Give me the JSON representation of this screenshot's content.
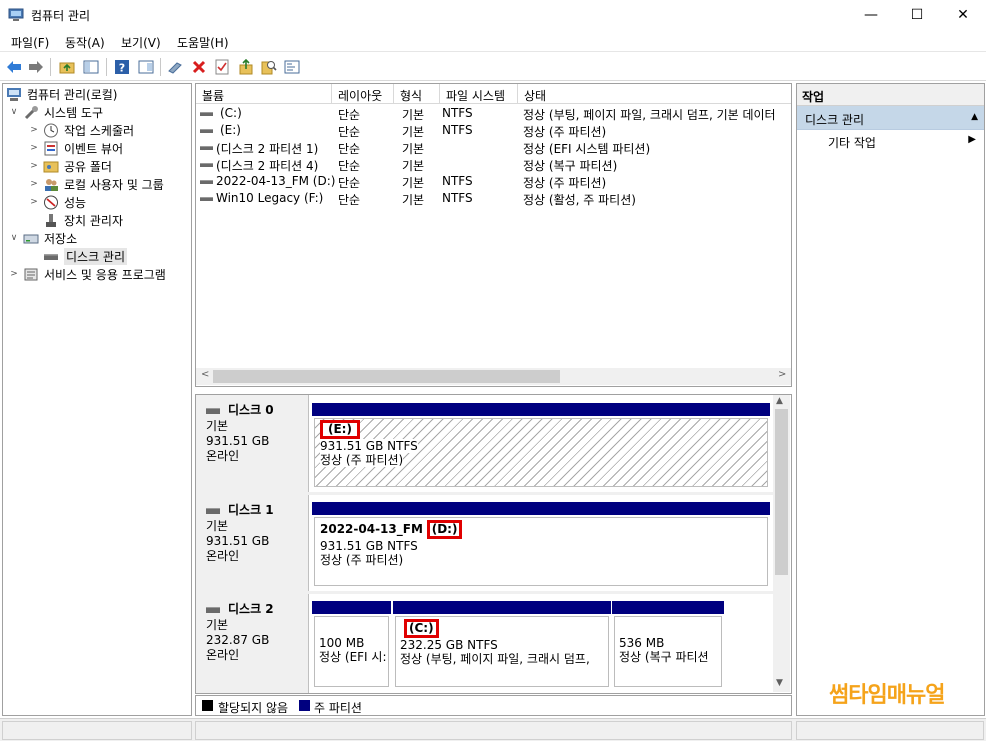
{
  "window": {
    "title": "컴퓨터 관리",
    "minimize": "—",
    "maximize": "☐",
    "close": "✕"
  },
  "menu": [
    "파일(F)",
    "동작(A)",
    "보기(V)",
    "도움말(H)"
  ],
  "toolbar": [
    "back-icon",
    "forward-icon",
    "up-folder-icon",
    "show-hide-tree-icon",
    "help-icon",
    "properties-icon",
    "connect-icon",
    "delete-icon",
    "check-icon",
    "export-icon",
    "search-icon",
    "console-icon"
  ],
  "tree": [
    {
      "label": "컴퓨터 관리(로컬)",
      "level": 0,
      "expander": "",
      "icon": "computer-management-icon"
    },
    {
      "label": "시스템 도구",
      "level": 1,
      "expander": "∨",
      "icon": "tools-icon"
    },
    {
      "label": "작업 스케줄러",
      "level": 2,
      "expander": ">",
      "icon": "clock-icon"
    },
    {
      "label": "이벤트 뷰어",
      "level": 2,
      "expander": ">",
      "icon": "event-viewer-icon"
    },
    {
      "label": "공유 폴더",
      "level": 2,
      "expander": ">",
      "icon": "shared-folder-icon"
    },
    {
      "label": "로컬 사용자 및 그룹",
      "level": 2,
      "expander": ">",
      "icon": "users-icon"
    },
    {
      "label": "성능",
      "level": 2,
      "expander": ">",
      "icon": "performance-icon"
    },
    {
      "label": "장치 관리자",
      "level": 2,
      "expander": "",
      "icon": "device-manager-icon"
    },
    {
      "label": "저장소",
      "level": 1,
      "expander": "∨",
      "icon": "storage-icon"
    },
    {
      "label": "디스크 관리",
      "level": 2,
      "expander": "",
      "icon": "disk-management-icon",
      "selected": true
    },
    {
      "label": "서비스 및 응용 프로그램",
      "level": 1,
      "expander": ">",
      "icon": "services-icon"
    }
  ],
  "volume_table": {
    "columns": [
      "볼륨",
      "레이아웃",
      "형식",
      "파일 시스템",
      "상태"
    ],
    "rows": [
      {
        "volume": "(C:)",
        "layout": "단순",
        "type": "기본",
        "fs": "NTFS",
        "status": "정상 (부팅, 페이지 파일, 크래시 덤프, 기본 데이터"
      },
      {
        "volume": "(E:)",
        "layout": "단순",
        "type": "기본",
        "fs": "NTFS",
        "status": "정상 (주 파티션)"
      },
      {
        "volume": "(디스크 2 파티션 1)",
        "layout": "단순",
        "type": "기본",
        "fs": "",
        "status": "정상 (EFI 시스템 파티션)"
      },
      {
        "volume": "(디스크 2 파티션 4)",
        "layout": "단순",
        "type": "기본",
        "fs": "",
        "status": "정상 (복구 파티션)"
      },
      {
        "volume": "2022-04-13_FM (D:)",
        "layout": "단순",
        "type": "기본",
        "fs": "NTFS",
        "status": "정상 (주 파티션)"
      },
      {
        "volume": "Win10 Legacy (F:)",
        "layout": "단순",
        "type": "기본",
        "fs": "NTFS",
        "status": "정상 (활성, 주 파티션)"
      }
    ]
  },
  "disks": [
    {
      "name": "디스크 0",
      "type": "기본",
      "size": "931.51 GB",
      "state": "온라인",
      "partitions": [
        {
          "label": "(E:)",
          "size_fs": "931.51 GB NTFS",
          "status": "정상 (주 파티션)"
        }
      ]
    },
    {
      "name": "디스크 1",
      "type": "기본",
      "size": "931.51 GB",
      "state": "온라인",
      "partitions": [
        {
          "label_prefix": "2022-04-13_FM",
          "label": "(D:)",
          "size_fs": "931.51 GB NTFS",
          "status": "정상 (주 파티션)"
        }
      ]
    },
    {
      "name": "디스크 2",
      "type": "기본",
      "size": "232.87 GB",
      "state": "온라인",
      "partitions": [
        {
          "label": "",
          "size_fs": "100 MB",
          "status": "정상 (EFI 시:"
        },
        {
          "label": "(C:)",
          "size_fs": "232.25 GB NTFS",
          "status": "정상 (부팅, 페이지 파일, 크래시 덤프,"
        },
        {
          "label": "",
          "size_fs": "536 MB",
          "status": "정상 (복구 파티션"
        }
      ]
    }
  ],
  "legend": [
    {
      "label": "할당되지 않음",
      "color": "#000000"
    },
    {
      "label": "주 파티션",
      "color": "#00007f"
    }
  ],
  "actions": {
    "header": "작업",
    "section": "디스크 관리",
    "item": "기타 작업"
  },
  "watermark": "썸타임매뉴얼",
  "colors": {
    "primary_partition": "#00007f",
    "highlight_box": "#e00000",
    "actions_section": "#c5d7e8",
    "watermark": "#f5a31a"
  }
}
